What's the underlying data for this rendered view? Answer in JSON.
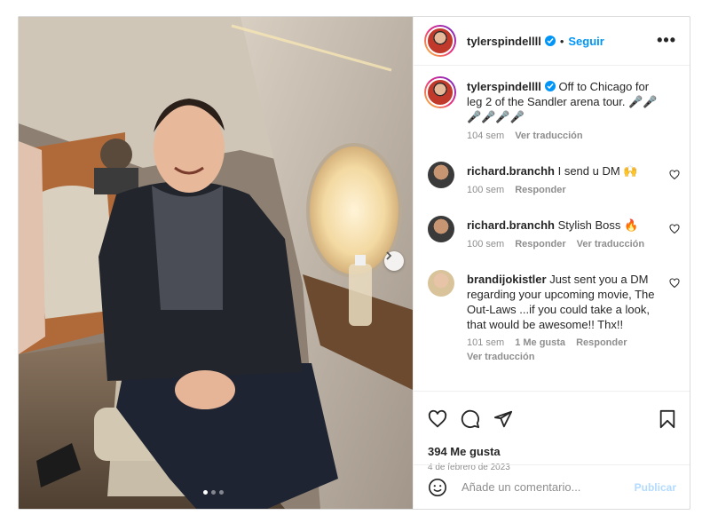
{
  "post": {
    "username": "tylerspindellll",
    "follow_label": "Seguir",
    "more_label": "•••",
    "separator": "•",
    "caption": "Off to Chicago for leg 2 of the Sandler arena tour. 🎤🎤🎤🎤🎤🎤",
    "caption_time": "104 sem",
    "caption_translate": "Ver traducción",
    "media_dots": 3,
    "active_dot": 0
  },
  "comments": [
    {
      "username": "richard.branchh",
      "text": "I send u DM 🙌",
      "time": "100 sem",
      "reply": "Responder",
      "translate": ""
    },
    {
      "username": "richard.branchh",
      "text": "Stylish Boss 🔥",
      "time": "100 sem",
      "reply": "Responder",
      "translate": "Ver traducción"
    },
    {
      "username": "brandijokistler",
      "text": "Just sent you a DM regarding your upcoming movie, The Out-Laws ...if you could take a look, that would be awesome!! Thx!!",
      "time": "101 sem",
      "likes": "1 Me gusta",
      "reply": "Responder",
      "translate": "Ver traducción"
    }
  ],
  "footer": {
    "likes": "394 Me gusta",
    "date": "4 de febrero de 2023",
    "comment_placeholder": "Añade un comentario...",
    "publish_label": "Publicar"
  },
  "colors": {
    "accent": "#0095f6",
    "muted": "#8e8e8e",
    "publish_disabled": "#b3dbff"
  },
  "icons": [
    "like-icon",
    "comment-icon",
    "share-icon",
    "save-icon",
    "emoji-icon",
    "more-icon",
    "verified-badge-icon",
    "chevron-right-icon"
  ]
}
